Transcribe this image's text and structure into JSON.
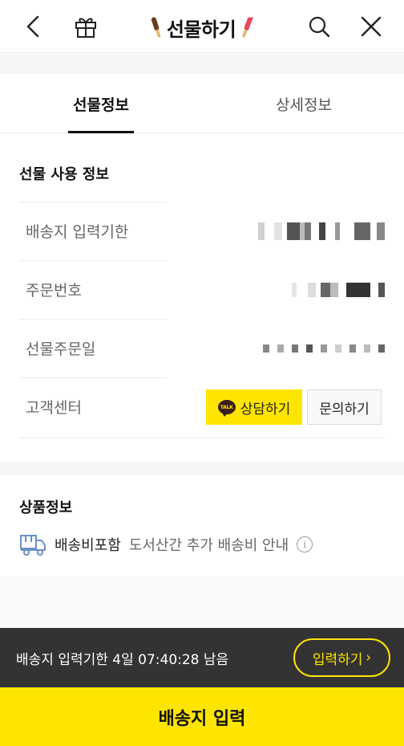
{
  "header": {
    "title": "선물하기",
    "back_icon": "chevron-left-icon",
    "gift_icon": "gift-box-icon",
    "search_icon": "search-icon",
    "close_icon": "close-icon"
  },
  "tabs": [
    {
      "label": "선물정보",
      "active": true
    },
    {
      "label": "상세정보",
      "active": false
    }
  ],
  "gift_usage": {
    "title": "선물 사용 정보",
    "rows": [
      {
        "label": "배송지 입력기한"
      },
      {
        "label": "주문번호"
      },
      {
        "label": "선물주문일"
      },
      {
        "label": "고객센터"
      }
    ],
    "talk_badge": "TALK",
    "consult_button": "상담하기",
    "inquiry_button": "문의하기"
  },
  "product_info": {
    "title": "상품정보",
    "shipping_included": "배송비포함",
    "shipping_note": "도서산간 추가 배송비 안내",
    "info_icon": "info-circle-icon"
  },
  "bottom": {
    "deadline_text": "배송지 입력기한 4일 07:40:28 남음",
    "input_button": "입력하기",
    "input_chevron": "›",
    "cta_label": "배송지 입력"
  },
  "colors": {
    "accent": "#fee500",
    "dark_bar": "#333333",
    "talk_brown": "#3a1d1d"
  }
}
